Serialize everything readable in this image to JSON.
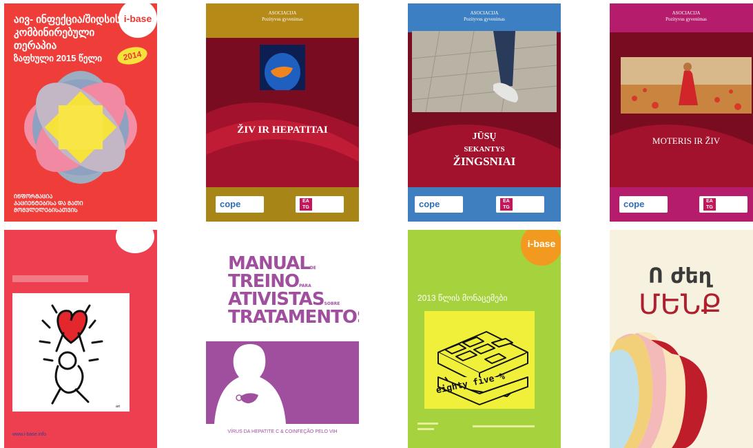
{
  "covers": {
    "georgian": {
      "title": "აივ- ინფექცია/შიდსის კომბინირებული თერაპია",
      "subtitle": "ზაფხული 2015 წელი",
      "badge": "2014",
      "logo": "i-base",
      "footer": "ᲘᲜᲤᲝᲠᲛᲐᲪᲘᲐ ᲞᲐᲪᲘᲔᲜᲢᲔᲑᲘᲡᲐ ᲓᲐ ᲛᲐᲗᲘ ᲛᲝᲛᲕᲚᲔᲚᲔᲑᲘᲡᲐᲗᲕᲘᲡ"
    },
    "ziv_hepatitai": {
      "org": "ASOCIACIJA\nPozityvus gyvenimas",
      "title": "ŽIV IR HEPATITAI",
      "logo_left": "cope",
      "logo_right": "EA TG"
    },
    "zingsniai": {
      "org": "ASOCIACIJA\nPozityvus gyvenimas",
      "line1": "JŪSŲ",
      "line2": "SEKANTYS",
      "line3": "ŽINGSNIAI",
      "logo_left": "cope",
      "logo_right": "EA TG"
    },
    "moteris": {
      "org": "ASOCIACIJA\nPozityvus gyvenimas",
      "title": "MOTERIS IR ŽIV",
      "logo_left": "cope",
      "logo_right": "EA TG"
    },
    "haring": {
      "footer": "www.i-base.info"
    },
    "manual": {
      "w1": "MANUAL",
      "s1": "DE",
      "w2": "TREINO",
      "s2": "PARA",
      "w3": "ATIVISTAS",
      "s3": "SOBRE",
      "w4": "TRATAMENTOS",
      "bottom": "VÍRUS DA HEPATITE C & COINFEÇÃO PELO VIH"
    },
    "eighty_five": {
      "logo": "i-base",
      "header": "2013 წლის მონაცემები",
      "box_text": "eighty five %"
    },
    "armenian": {
      "line1": "Ո ժեղ",
      "line2": "ՄԵՆՔ"
    }
  },
  "colors": {
    "georgian_bg": "#ef3e3a",
    "lt_dark_red": "#7d0c22",
    "haring_bg": "#ee3f50",
    "manual_purple": "#a04f9e",
    "eighty_green": "#a6d23d",
    "eighty_yellow": "#f0f03a"
  }
}
